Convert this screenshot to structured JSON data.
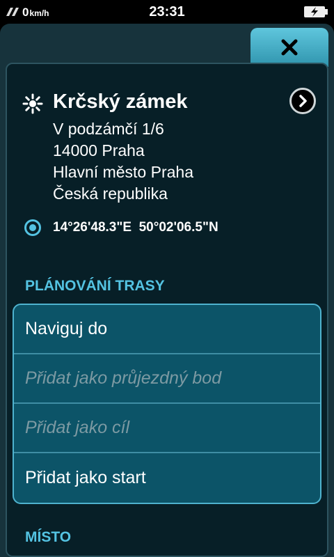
{
  "status_bar": {
    "speed": "0",
    "speed_unit": "km/h",
    "time": "23:31",
    "signal_icon": "satellite-signal-icon",
    "battery_icon": "battery-charging-icon"
  },
  "close_icon": "close-icon",
  "place": {
    "icon": "sun-poi-icon",
    "name": "Krčský zámek",
    "address_lines": [
      "V podzámčí 1/6",
      "14000 Praha",
      "Hlavní město Praha",
      "Česká republika"
    ],
    "coordinates": "14°26'48.3\"E  50°02'06.5\"N",
    "coord_icon": "location-target-icon",
    "info_icon": "chevron-right-icon"
  },
  "route_planning": {
    "heading": "PLÁNOVÁNÍ TRASY",
    "items": [
      {
        "label": "Naviguj do",
        "enabled": true
      },
      {
        "label": "Přidat jako průjezdný bod",
        "enabled": false
      },
      {
        "label": "Přidat jako cíl",
        "enabled": false
      },
      {
        "label": "Přidat jako start",
        "enabled": true
      }
    ]
  },
  "place_section": {
    "heading": "MÍSTO"
  },
  "colors": {
    "accent": "#54c3e2",
    "panel_bg": "#17333c",
    "content_bg": "#071f27",
    "menu_bg": "#0c5468",
    "disabled_text": "#7d9aa3"
  }
}
